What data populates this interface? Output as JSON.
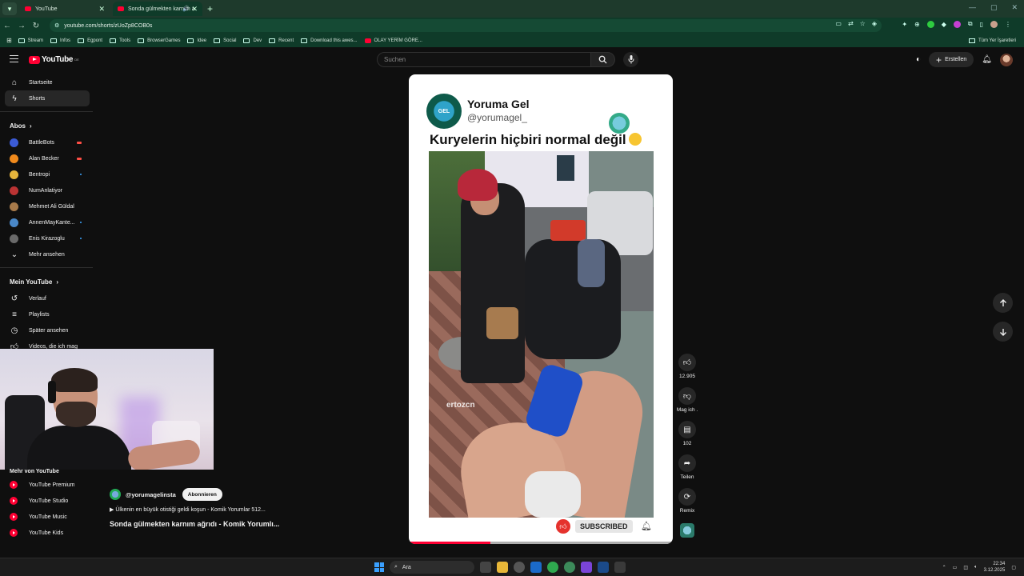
{
  "browser": {
    "tabs": [
      {
        "label": "YouTube",
        "active": false
      },
      {
        "label": "Sonda gülmekten karnım a",
        "active": true
      }
    ],
    "url": "youtube.com/shorts/zUoZp8COB0s",
    "bookmarks": [
      "Stream",
      "Infos",
      "Egpont",
      "Tools",
      "BrowserGames",
      "Idee",
      "Social",
      "Dev",
      "Recent",
      "Download this awes...",
      "OLAY YERİM GÖRE..."
    ],
    "bookmarks_right": "Tüm Yer İşaretleri"
  },
  "youtube": {
    "logo": "YouTube",
    "logo_country": "DE",
    "search_placeholder": "Suchen",
    "create_label": "Erstellen"
  },
  "sidebar": {
    "main": [
      {
        "label": "Startseite",
        "icon": "home-icon"
      },
      {
        "label": "Shorts",
        "icon": "shorts-icon",
        "active": true
      }
    ],
    "subs_heading": "Abos",
    "subscriptions": [
      {
        "label": "BattleBots",
        "color": "#3b5bd6",
        "live": true
      },
      {
        "label": "Alan Becker",
        "color": "#f08a1c",
        "live": true
      },
      {
        "label": "Bentropi",
        "color": "#e6b53c",
        "dot": true
      },
      {
        "label": "NumAnlatiyor",
        "color": "#b33",
        "dot": false
      },
      {
        "label": "Mehmet Ali Güldal",
        "color": "#a87a4a",
        "dot": false
      },
      {
        "label": "AnnenMayKante...",
        "color": "#4a88c8",
        "dot": true
      },
      {
        "label": "Enis Kirazoglu",
        "color": "#6a6a6a",
        "dot": true
      }
    ],
    "more_label": "Mehr ansehen",
    "you_heading": "Mein YouTube",
    "you_items": [
      {
        "label": "Verlauf",
        "icon": "history-icon"
      },
      {
        "label": "Playlists",
        "icon": "playlist-icon"
      },
      {
        "label": "Später ansehen",
        "icon": "clock-icon"
      },
      {
        "label": "Videos, die ich mag",
        "icon": "thumbs-up-icon"
      }
    ],
    "more_yt_heading": "Mehr von YouTube",
    "more_yt": [
      {
        "label": "YouTube Premium"
      },
      {
        "label": "YouTube Studio"
      },
      {
        "label": "YouTube Music"
      },
      {
        "label": "YouTube Kids"
      }
    ]
  },
  "short": {
    "post_name": "Yoruma Gel",
    "post_handle": "@yorumagel_",
    "post_caption": "Kuryelerin hiçbiri normal değil",
    "watermark": "ertozcn",
    "subscribed_label": "SUBSCRIBED",
    "progress": 0.31,
    "channel": "@yorumagelinsta",
    "subscribe_label": "Abonnieren",
    "music": "▶ Ülkenin en büyük otistiği geldi koşun - Komik Yorumlar 512...",
    "title": "Sonda gülmekten karnım ağrıdı - Komik Yorumlı..."
  },
  "actions": {
    "likes": "12.905",
    "dislike_label": "Mag ich .",
    "comments": "102",
    "share_label": "Teilen",
    "remix_label": "Remix"
  },
  "taskbar": {
    "search_label": "Ara",
    "time": "22:34",
    "date": "3.12.2025"
  },
  "colors": {
    "brand_red": "#ff0033",
    "browser_green": "#0f3b29",
    "background": "#0f0f0f"
  }
}
